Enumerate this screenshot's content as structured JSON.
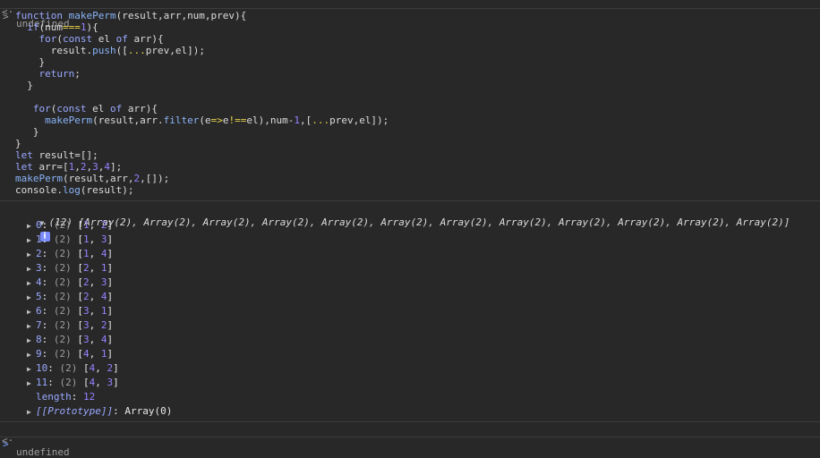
{
  "top_result": "undefined",
  "code_lines": [
    "function makePerm(result,arr,num,prev){",
    "  if(num===1){",
    "    for(const el of arr){",
    "      result.push([...prev,el]);",
    "    }",
    "    return;",
    "  }",
    "",
    "   for(const el of arr){",
    "     makePerm(result,arr.filter(e=>e!==el),num-1,[...prev,el]);",
    "   }",
    "}",
    "let result=[];",
    "let arr=[1,2,3,4];",
    "makePerm(result,arr,2,[]);",
    "console.log(result);"
  ],
  "summary": "(12) [Array(2), Array(2), Array(2), Array(2), Array(2), Array(2), Array(2), Array(2), Array(2), Array(2), Array(2), Array(2)]",
  "entries": [
    {
      "index": "0",
      "len": "(2)",
      "value": "[1, 2]"
    },
    {
      "index": "1",
      "len": "(2)",
      "value": "[1, 3]"
    },
    {
      "index": "2",
      "len": "(2)",
      "value": "[1, 4]"
    },
    {
      "index": "3",
      "len": "(2)",
      "value": "[2, 1]"
    },
    {
      "index": "4",
      "len": "(2)",
      "value": "[2, 3]"
    },
    {
      "index": "5",
      "len": "(2)",
      "value": "[2, 4]"
    },
    {
      "index": "6",
      "len": "(2)",
      "value": "[3, 1]"
    },
    {
      "index": "7",
      "len": "(2)",
      "value": "[3, 2]"
    },
    {
      "index": "8",
      "len": "(2)",
      "value": "[3, 4]"
    },
    {
      "index": "9",
      "len": "(2)",
      "value": "[4, 1]"
    },
    {
      "index": "10",
      "len": "(2)",
      "value": "[4, 2]"
    },
    {
      "index": "11",
      "len": "(2)",
      "value": "[4, 3]"
    }
  ],
  "length_label": "length",
  "length_value": "12",
  "prototype_label": "[[Prototype]]",
  "prototype_value": "Array(0)",
  "bottom_result": "undefined",
  "info_icon": "i",
  "icons": {
    "input_prompt": "chevron-right-icon",
    "result_marker": "return-arrow-icon",
    "expand": "triangle-right-icon",
    "collapse": "triangle-down-icon",
    "info": "info-icon"
  }
}
